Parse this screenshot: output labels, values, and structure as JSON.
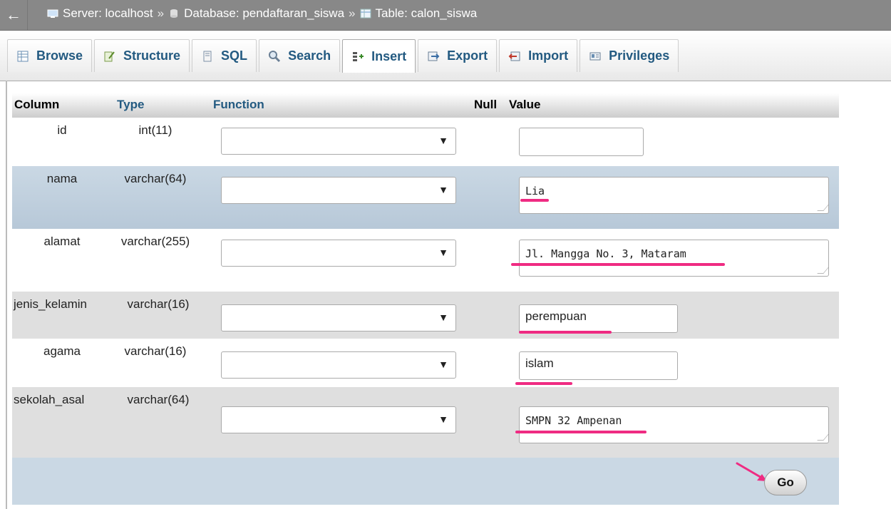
{
  "breadcrumb": {
    "back_glyph": "←",
    "server": "Server: localhost",
    "sep1": "»",
    "database": "Database: pendaftaran_siswa",
    "sep2": "»",
    "table": "Table: calon_siswa"
  },
  "tabs": [
    {
      "label": "Browse",
      "icon": "browse-icon"
    },
    {
      "label": "Structure",
      "icon": "structure-icon"
    },
    {
      "label": "SQL",
      "icon": "sql-icon"
    },
    {
      "label": "Search",
      "icon": "search-icon"
    },
    {
      "label": "Insert",
      "icon": "insert-icon",
      "active": true
    },
    {
      "label": "Export",
      "icon": "export-icon"
    },
    {
      "label": "Import",
      "icon": "import-icon"
    },
    {
      "label": "Privileges",
      "icon": "privileges-icon"
    }
  ],
  "headers": {
    "column": "Column",
    "type": "Type",
    "function": "Function",
    "null": "Null",
    "value": "Value"
  },
  "rows": [
    {
      "name": "id",
      "type": "int(11)",
      "value": ""
    },
    {
      "name": "nama",
      "type": "varchar(64)",
      "value": "Lia"
    },
    {
      "name": "alamat",
      "type": "varchar(255)",
      "value": "Jl. Mangga No. 3, Mataram"
    },
    {
      "name": "jenis_kelamin",
      "type": "varchar(16)",
      "value": "perempuan"
    },
    {
      "name": "agama",
      "type": "varchar(16)",
      "value": "islam"
    },
    {
      "name": "sekolah_asal",
      "type": "varchar(64)",
      "value": "SMPN 32 Ampenan"
    }
  ],
  "go_label": "Go",
  "colors": {
    "annotation": "#ef2b82",
    "link": "#235a81",
    "highlight_row": "#cad8e4"
  }
}
